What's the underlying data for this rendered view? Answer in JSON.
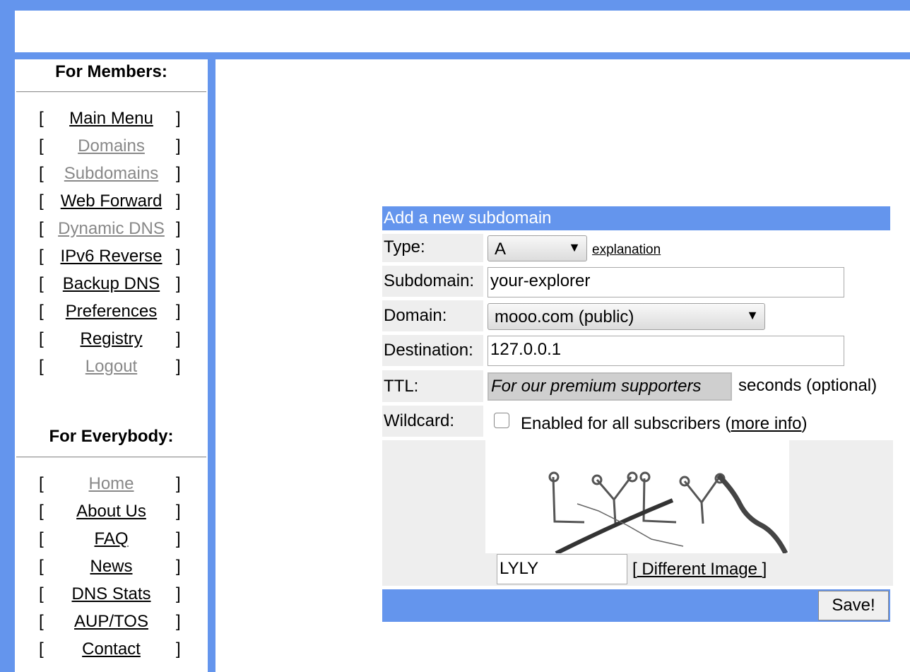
{
  "sidebar": {
    "members_heading": "For Members:",
    "members_items": [
      {
        "label": "Main Menu",
        "visited": false
      },
      {
        "label": "Domains",
        "visited": true
      },
      {
        "label": "Subdomains",
        "visited": true
      },
      {
        "label": "Web Forward",
        "visited": false
      },
      {
        "label": "Dynamic DNS",
        "visited": true
      },
      {
        "label": "IPv6 Reverse",
        "visited": false
      },
      {
        "label": "Backup DNS",
        "visited": false
      },
      {
        "label": "Preferences",
        "visited": false
      },
      {
        "label": "Registry",
        "visited": false
      },
      {
        "label": "Logout",
        "visited": true
      }
    ],
    "everybody_heading": "For Everybody:",
    "everybody_items": [
      {
        "label": "Home",
        "visited": true
      },
      {
        "label": "About Us",
        "visited": false
      },
      {
        "label": "FAQ",
        "visited": false
      },
      {
        "label": "News",
        "visited": false
      },
      {
        "label": "DNS Stats",
        "visited": false
      },
      {
        "label": "AUP/TOS",
        "visited": false
      },
      {
        "label": "Contact",
        "visited": false
      }
    ],
    "bracket_open": "[",
    "bracket_close": "]"
  },
  "form": {
    "title": "Add a new subdomain",
    "type_label": "Type:",
    "type_value": "A",
    "explanation_link": "explanation",
    "subdomain_label": "Subdomain:",
    "subdomain_value": "your-explorer",
    "domain_label": "Domain:",
    "domain_value": "mooo.com (public)",
    "destination_label": "Destination:",
    "destination_value": "127.0.0.1",
    "ttl_label": "TTL:",
    "ttl_placeholder": "For our premium supporters",
    "ttl_suffix": "seconds (optional)",
    "wildcard_label": "Wildcard:",
    "wildcard_checked": false,
    "wildcard_text_before": "Enabled for all subscribers (",
    "wildcard_link": "more info",
    "wildcard_text_after": ")",
    "captcha_value": "LYLY",
    "different_image_open": "[",
    "different_image_link": " Different Image ",
    "different_image_close": "]",
    "save_label": "Save!"
  },
  "colors": {
    "accent": "#6495ed",
    "field_bg": "#eeeeee",
    "visited_link": "#888888"
  }
}
